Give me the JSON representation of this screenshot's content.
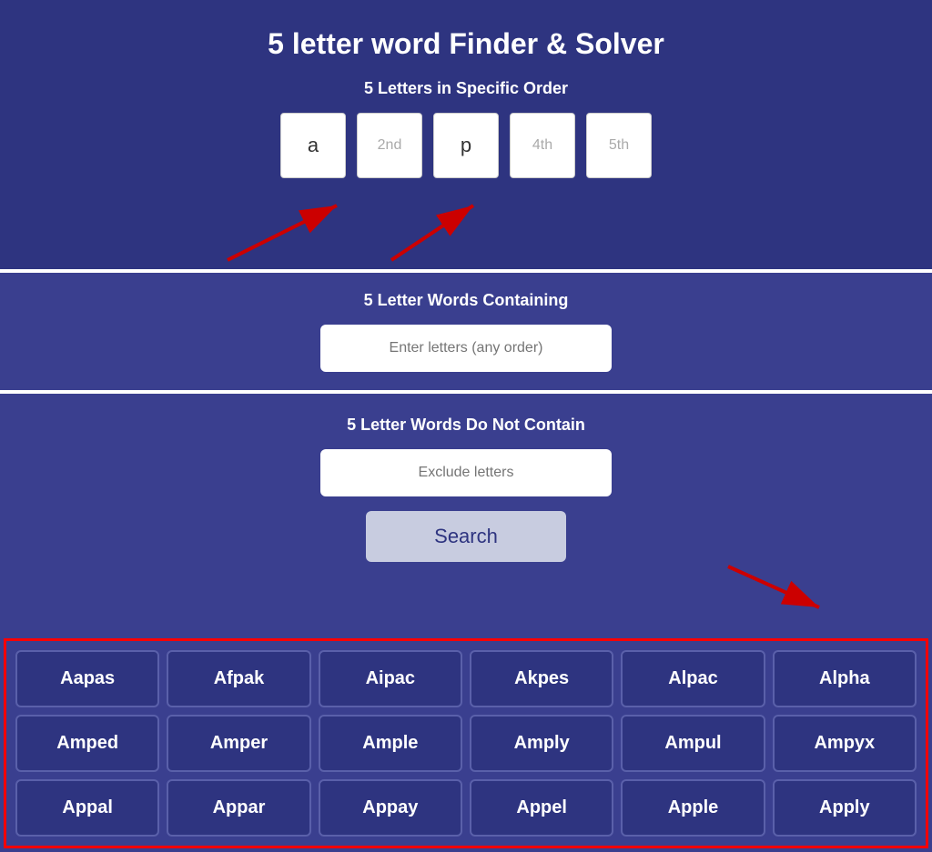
{
  "page": {
    "title": "5 letter word Finder & Solver"
  },
  "specific_order": {
    "label": "5 Letters in Specific Order",
    "boxes": [
      {
        "value": "a",
        "placeholder": false
      },
      {
        "value": "2nd",
        "placeholder": true
      },
      {
        "value": "p",
        "placeholder": false
      },
      {
        "value": "4th",
        "placeholder": true
      },
      {
        "value": "5th",
        "placeholder": true
      }
    ]
  },
  "containing": {
    "label": "5 Letter Words Containing",
    "placeholder": "Enter letters (any order)"
  },
  "do_not_contain": {
    "label": "5 Letter Words Do Not Contain",
    "placeholder": "Exclude letters"
  },
  "search_button": {
    "label": "Search"
  },
  "results": {
    "words": [
      "Aapas",
      "Afpak",
      "Aipac",
      "Akpes",
      "Alpac",
      "Alpha",
      "Amped",
      "Amper",
      "Ample",
      "Amply",
      "Ampul",
      "Ampyx",
      "Appal",
      "Appar",
      "Appay",
      "Appel",
      "Apple",
      "Apply"
    ]
  }
}
